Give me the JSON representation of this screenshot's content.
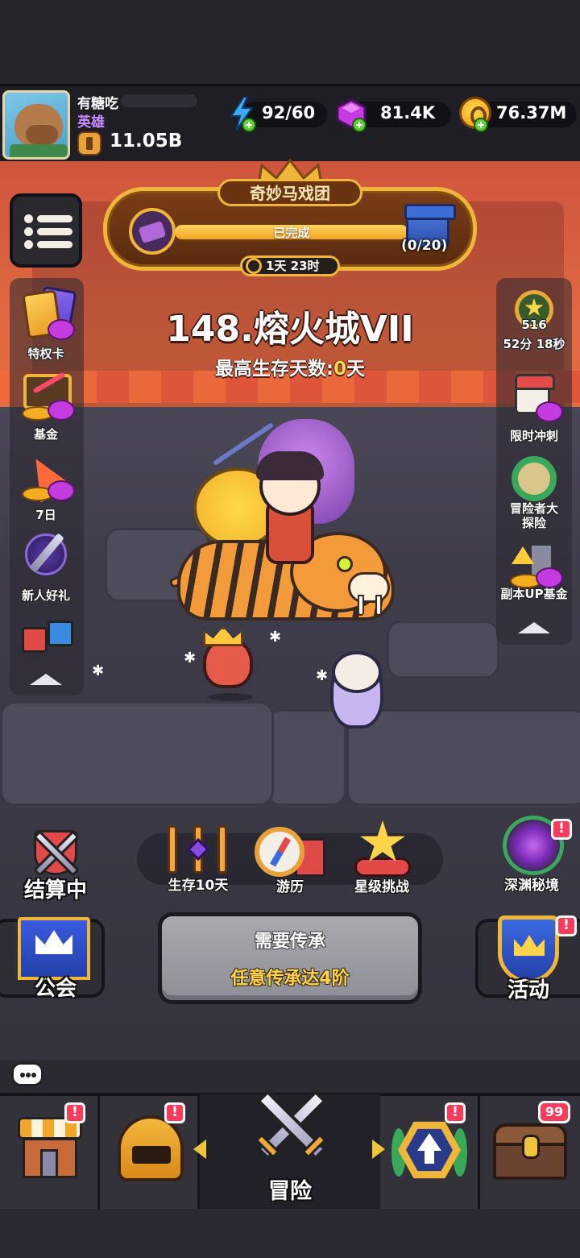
{
  "player": {
    "name": "有糖吃",
    "title": "英雄",
    "power": "11.05B"
  },
  "resources": {
    "energy": "92/60",
    "gems": "81.4K",
    "gold": "76.37M"
  },
  "event_banner": {
    "title": "奇妙马戏团",
    "status": "已完成",
    "progress": "(0/20)",
    "timer": "1天 23时"
  },
  "stage": {
    "name": "148.熔火城VII",
    "subtitle_prefix": "最高生存天数:",
    "days": "0",
    "subtitle_suffix": "天"
  },
  "left_sidebar": [
    {
      "label": "特权卡",
      "icon": "privilege-card-icon"
    },
    {
      "label": "基金",
      "icon": "fund-icon"
    },
    {
      "label": "7日",
      "icon": "seven-day-icon"
    },
    {
      "label": "新人好礼",
      "icon": "newbie-gift-icon"
    },
    {
      "label": "",
      "icon": "gift-bundle-icon"
    }
  ],
  "right_sidebar": [
    {
      "label": "52分 18秒",
      "badge": "516",
      "icon": "battle-pass-icon"
    },
    {
      "label": "限时冲刺",
      "icon": "calendar-sprint-icon"
    },
    {
      "label": "冒险者大\n探险",
      "icon": "adventurer-expedition-icon"
    },
    {
      "label": "副本UP基金",
      "icon": "dungeon-fund-icon"
    }
  ],
  "actions": {
    "settle": "结算中",
    "survive": "生存10天",
    "travel": "游历",
    "star_challenge": "星级挑战",
    "abyss": "深渊秘境"
  },
  "middle": {
    "guild": "公会",
    "inherit_title": "需要传承",
    "inherit_req": "任意传承达4阶",
    "events": "活动"
  },
  "notifications": {
    "mark": "!",
    "chest_count": "99"
  },
  "bottom_nav": {
    "center_label": "冒险"
  },
  "colors": {
    "sky": "#d35a3e",
    "gold_accent": "#f0b63a",
    "notify_red": "#ff3a5a",
    "highlight_yellow": "#ffd84a",
    "title_purple": "#c98cff"
  }
}
